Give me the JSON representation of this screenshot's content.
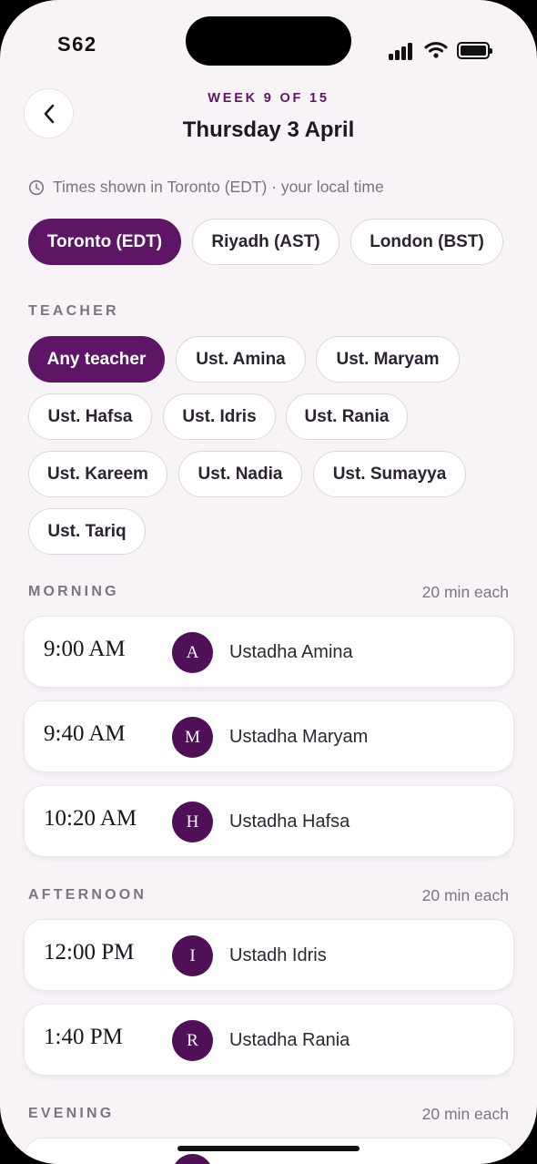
{
  "status_bar": {
    "time": "S62"
  },
  "header": {
    "week_label": "WEEK 9 OF 15",
    "date_title": "Thursday 3 April"
  },
  "timezone_note": "Times shown in Toronto (EDT) · your local time",
  "timezones": [
    {
      "label": "Toronto (EDT)",
      "selected": true
    },
    {
      "label": "Riyadh (AST)",
      "selected": false
    },
    {
      "label": "London (BST)",
      "selected": false
    }
  ],
  "teacher_section": {
    "label": "TEACHER",
    "chips": [
      {
        "label": "Any teacher",
        "selected": true
      },
      {
        "label": "Ust. Amina",
        "selected": false
      },
      {
        "label": "Ust. Maryam",
        "selected": false
      },
      {
        "label": "Ust. Hafsa",
        "selected": false
      },
      {
        "label": "Ust. Idris",
        "selected": false
      },
      {
        "label": "Ust. Rania",
        "selected": false
      },
      {
        "label": "Ust. Kareem",
        "selected": false
      },
      {
        "label": "Ust. Nadia",
        "selected": false
      },
      {
        "label": "Ust. Sumayya",
        "selected": false
      },
      {
        "label": "Ust. Tariq",
        "selected": false
      }
    ]
  },
  "sections": {
    "morning": {
      "label": "MORNING",
      "note": "20 min each",
      "slots": [
        {
          "time": "9:00 AM",
          "initial": "A",
          "teacher": "Ustadha Amina"
        },
        {
          "time": "9:40 AM",
          "initial": "M",
          "teacher": "Ustadha Maryam"
        },
        {
          "time": "10:20 AM",
          "initial": "H",
          "teacher": "Ustadha Hafsa"
        }
      ]
    },
    "afternoon": {
      "label": "AFTERNOON",
      "note": "20 min each",
      "slots": [
        {
          "time": "12:00 PM",
          "initial": "I",
          "teacher": "Ustadh Idris"
        },
        {
          "time": "1:40 PM",
          "initial": "R",
          "teacher": "Ustadha Rania"
        }
      ]
    },
    "evening": {
      "label": "EVENING",
      "note": "20 min each",
      "slots": [
        {
          "time": "",
          "initial": "",
          "teacher": ""
        }
      ]
    }
  },
  "colors": {
    "accent": "#5e1566",
    "background": "#f7f3f7",
    "card": "#ffffff"
  }
}
